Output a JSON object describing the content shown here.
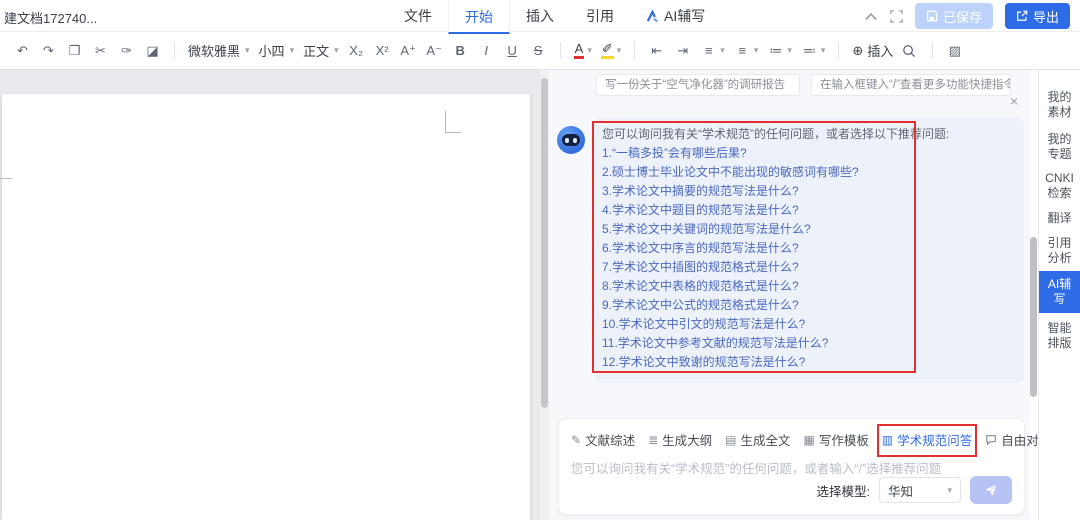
{
  "header": {
    "doc_title": "建文档172740...",
    "menu_items": [
      {
        "label": "文件"
      },
      {
        "label": "开始"
      },
      {
        "label": "插入"
      },
      {
        "label": "引用"
      },
      {
        "label": "AI辅写"
      }
    ],
    "save_button": "已保存",
    "export_button": "导出"
  },
  "toolbar": {
    "font_name": "微软雅黑",
    "font_size": "小四",
    "paragraph_style": "正文",
    "subscript": "X₂",
    "superscript": "X²",
    "font_larger": "A⁺",
    "font_smaller": "A⁻",
    "bold": "B",
    "italic": "I",
    "underline": "U",
    "strike": "S",
    "font_color_letter": "A",
    "insert_label": "插入"
  },
  "chat": {
    "chips": [
      "写一份关于“空气净化器”的调研报告",
      "在输入框键入“/”查看更多功能快捷指令"
    ],
    "close_label": "×",
    "message_intro": "您可以询问我有关“学术规范”的任何问题，或者选择以下推荐问题:",
    "questions": [
      "1.“一稿多投”会有哪些后果?",
      "2.硕士博士毕业论文中不能出现的敏感词有哪些?",
      "3.学术论文中摘要的规范写法是什么?",
      "4.学术论文中题目的规范写法是什么?",
      "5.学术论文中关键词的规范写法是什么?",
      "6.学术论文中序言的规范写法是什么?",
      "7.学术论文中插图的规范格式是什么?",
      "8.学术论文中表格的规范格式是什么?",
      "9.学术论文中公式的规范格式是什么?",
      "10.学术论文中引文的规范写法是什么?",
      "11.学术论文中参考文献的规范写法是什么?",
      "12.学术论文中致谢的规范写法是什么?"
    ]
  },
  "composer": {
    "tabs": [
      {
        "label": "文献综述"
      },
      {
        "label": "生成大纲"
      },
      {
        "label": "生成全文"
      },
      {
        "label": "写作模板"
      },
      {
        "label": "学术规范问答",
        "active": true
      },
      {
        "label": "自由对话"
      }
    ],
    "placeholder": "您可以询问我有关“学术规范”的任何问题，或者输入“/”选择推荐问题",
    "model_label": "选择模型:",
    "model_value": "华知"
  },
  "sidebar": {
    "items": [
      {
        "label": "我的素材"
      },
      {
        "label": "我的专题"
      },
      {
        "label": "CNKI检索"
      },
      {
        "label": "翻译"
      },
      {
        "label": "引用分析"
      },
      {
        "label": "AI辅写",
        "active": true
      },
      {
        "label": "智能排版"
      }
    ]
  },
  "colors": {
    "accent": "#2e6be6",
    "annotation_red": "#e0312e",
    "font_color_red": "#e03131",
    "highlight_yellow": "#f3d633"
  }
}
